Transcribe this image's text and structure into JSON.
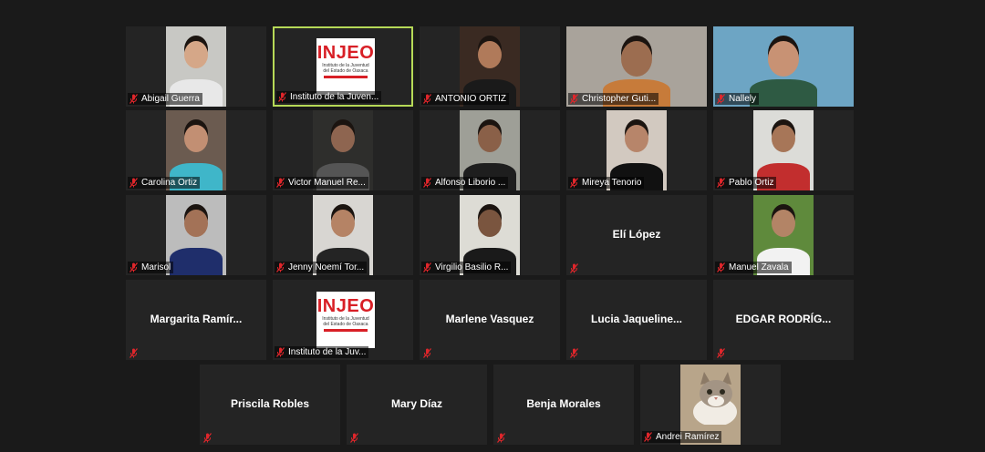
{
  "meeting": {
    "rows": [
      [
        {
          "name": "Abigail Guerra",
          "display": "video",
          "video_style": "portrait",
          "bg": "#c8c8c4",
          "skin": "#d5a788",
          "shirt": "#e8e8e8"
        },
        {
          "name": "Instituto de la Juventud del Estado de Oaxaca",
          "label": "Instituto de la Juven...",
          "display": "logo",
          "active": true
        },
        {
          "name": "ANTONIO ORTIZ",
          "display": "video",
          "video_style": "portrait",
          "bg": "#3a2a22",
          "skin": "#b07a5a",
          "shirt": "#1a1a1a"
        },
        {
          "name": "Christopher Gutiérrez",
          "label": "Christopher Guti...",
          "display": "video",
          "video_style": "wide",
          "bg": "#a9a39b",
          "skin": "#9c6d50",
          "shirt": "#c77b3a"
        },
        {
          "name": "Nallely",
          "display": "video",
          "video_style": "wide",
          "bg": "#6da5c4",
          "skin": "#c89274",
          "shirt": "#2e5a43"
        }
      ],
      [
        {
          "name": "Carolina Ortiz",
          "display": "video",
          "video_style": "portrait",
          "bg": "#6b5b50",
          "skin": "#c28f73",
          "shirt": "#3fb6c9"
        },
        {
          "name": "Victor Manuel Reyes",
          "label": "Victor Manuel Re...",
          "display": "video",
          "video_style": "portrait",
          "bg": "#2e2e2c",
          "skin": "#8e6550",
          "shirt": "#555"
        },
        {
          "name": "Alfonso Liborio",
          "label": "Alfonso Liborio ...",
          "display": "video",
          "video_style": "portrait",
          "bg": "#9e9f97",
          "skin": "#8a6048",
          "shirt": "#1e1e1e"
        },
        {
          "name": "Mireya Tenorio",
          "display": "video",
          "video_style": "portrait",
          "bg": "#d2c9c0",
          "skin": "#b7856a",
          "shirt": "#111"
        },
        {
          "name": "Pablo Ortiz",
          "display": "video",
          "video_style": "portrait",
          "bg": "#dcdcd8",
          "skin": "#a77658",
          "shirt": "#c22e2e"
        }
      ],
      [
        {
          "name": "Marisol",
          "display": "video",
          "video_style": "portrait",
          "bg": "#bcbcbc",
          "skin": "#a37257",
          "shirt": "#1f2e6b"
        },
        {
          "name": "Jenny Noemí Torres",
          "label": "Jenny Noemí Tor...",
          "display": "video",
          "video_style": "portrait",
          "bg": "#d8d6d2",
          "skin": "#b58365",
          "shirt": "#242424"
        },
        {
          "name": "Virgilio Basilio R.",
          "label": "Virgilio Basilio R...",
          "display": "video",
          "video_style": "portrait",
          "bg": "#dddcd5",
          "skin": "#7a553f",
          "shirt": "#1a1a1a"
        },
        {
          "name": "Elí López",
          "display": "name"
        },
        {
          "name": "Manuel Zavala",
          "display": "video",
          "video_style": "portrait",
          "bg": "#5f8a3c",
          "skin": "#b38466",
          "shirt": "#f2f2f2"
        }
      ],
      [
        {
          "name": "Margarita  Ramír...",
          "display": "name"
        },
        {
          "name": "Instituto de la Juventud del Estado de Oaxaca",
          "label": "Instituto de la Juv...",
          "display": "logo"
        },
        {
          "name": "Marlene Vasquez",
          "display": "name"
        },
        {
          "name": "Lucia  Jaqueline...",
          "display": "name"
        },
        {
          "name": "EDGAR  RODRÍG...",
          "display": "name"
        }
      ],
      [
        {
          "name": "Priscila Robles",
          "display": "name"
        },
        {
          "name": "Mary Díaz",
          "display": "name"
        },
        {
          "name": "Benja Morales",
          "display": "name"
        },
        {
          "name": "Andrei Ramírez",
          "display": "cat",
          "video_style": "portrait",
          "bg": "#b8a58a"
        }
      ]
    ],
    "logo": {
      "title": "INJEO",
      "subtitle": "Instituto de la Juventud del Estado de Oaxaca"
    },
    "colors": {
      "background": "#1a1a1a",
      "tile": "#242424",
      "active_border": "#b6d957",
      "muted_mic": "#e0262b",
      "logo_red": "#d81f26"
    },
    "icons": {
      "mic": "muted-mic-icon"
    }
  }
}
